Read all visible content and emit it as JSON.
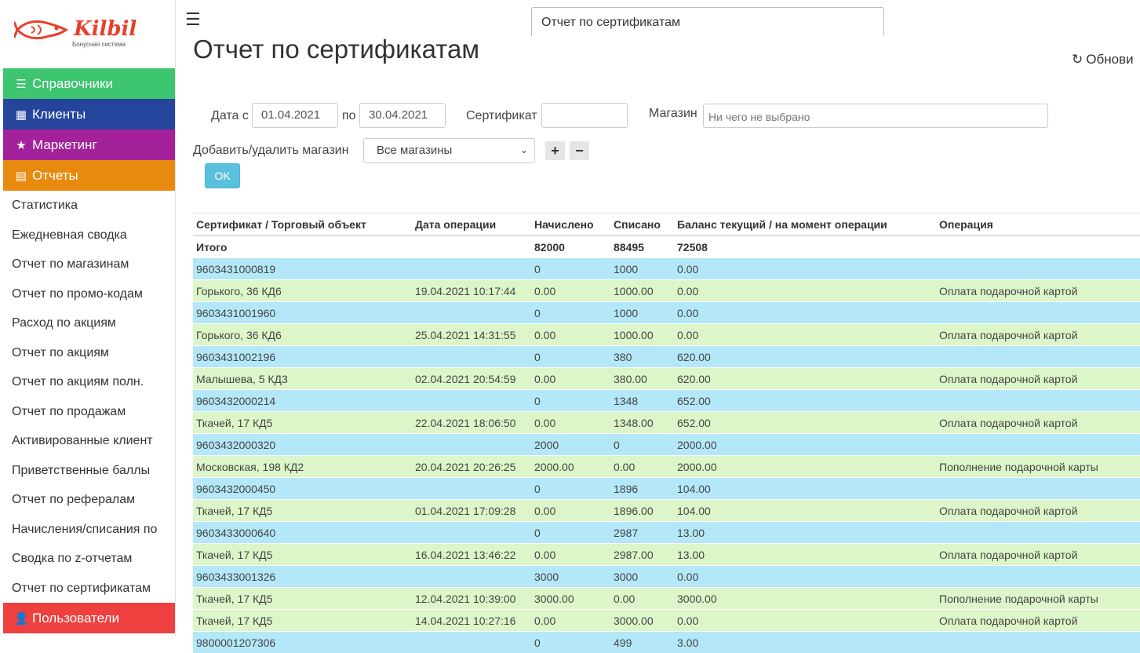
{
  "logo": {
    "brand": "Kilbil",
    "tagline": "Бонусная система"
  },
  "sidebar": {
    "main_top": [
      {
        "label": "Справочники",
        "icon": "list-icon",
        "color": "#3dc56f"
      },
      {
        "label": "Клиенты",
        "icon": "grid-icon",
        "color": "#25449b"
      },
      {
        "label": "Маркетинг",
        "icon": "star-icon",
        "color": "#a3219a"
      },
      {
        "label": "Отчеты",
        "icon": "report-icon",
        "color": "#e88a0e"
      }
    ],
    "reports": [
      "Статистика",
      "Ежедневная сводка",
      "Отчет по магазинам",
      "Отчет по промо-кодам",
      "Расход по акциям",
      "Отчет по акциям",
      "Отчет по акциям полн.",
      "Отчет по продажам",
      "Активированные клиент",
      "Приветственные баллы",
      "Отчет по рефералам",
      "Начисления/списания по",
      "Сводка по z-отчетам",
      "Отчет по сертификатам"
    ],
    "users": {
      "label": "Пользователи",
      "icon": "user-icon",
      "color": "#ef4040"
    }
  },
  "header": {
    "tab_label": "Отчет по сертификатам",
    "title": "Отчет по сертификатам",
    "refresh_label": "Обнови"
  },
  "filters": {
    "date_from_label": "Дата с",
    "date_from": "01.04.2021",
    "date_to_label": "по",
    "date_to": "30.04.2021",
    "certificate_label": "Сертификат",
    "certificate_value": "",
    "store_label": "Магазин",
    "store_placeholder": "Ни чего не выбрано",
    "add_remove_label": "Добавить/удалить магазин",
    "store_select": "Все магазины",
    "plus": "+",
    "minus": "−",
    "ok_label": "OK"
  },
  "table": {
    "columns": [
      "Сертификат / Торговый объект",
      "Дата операции",
      "Начислено",
      "Списано",
      "Баланс текущий / на момент операции",
      "Операция"
    ],
    "total": {
      "label": "Итого",
      "accrued": "82000",
      "written_off": "88495",
      "balance": "72508"
    },
    "rows": [
      {
        "kind": "cert",
        "cells": [
          "9603431000819",
          "",
          "0",
          "1000",
          "0.00",
          ""
        ]
      },
      {
        "kind": "op",
        "cells": [
          "Горького, 36 КД6",
          "19.04.2021 10:17:44",
          "0.00",
          "1000.00",
          "0.00",
          "Оплата подарочной картой"
        ]
      },
      {
        "kind": "cert",
        "cells": [
          "9603431001960",
          "",
          "0",
          "1000",
          "0.00",
          ""
        ]
      },
      {
        "kind": "op",
        "cells": [
          "Горького, 36 КД6",
          "25.04.2021 14:31:55",
          "0.00",
          "1000.00",
          "0.00",
          "Оплата подарочной картой"
        ]
      },
      {
        "kind": "cert",
        "cells": [
          "9603431002196",
          "",
          "0",
          "380",
          "620.00",
          ""
        ]
      },
      {
        "kind": "op",
        "cells": [
          "Малышева, 5 КД3",
          "02.04.2021 20:54:59",
          "0.00",
          "380.00",
          "620.00",
          "Оплата подарочной картой"
        ]
      },
      {
        "kind": "cert",
        "cells": [
          "9603432000214",
          "",
          "0",
          "1348",
          "652.00",
          ""
        ]
      },
      {
        "kind": "op",
        "cells": [
          "Ткачей, 17 КД5",
          "22.04.2021 18:06:50",
          "0.00",
          "1348.00",
          "652.00",
          "Оплата подарочной картой"
        ]
      },
      {
        "kind": "cert",
        "cells": [
          "9603432000320",
          "",
          "2000",
          "0",
          "2000.00",
          ""
        ]
      },
      {
        "kind": "op",
        "cells": [
          "Московская, 198 КД2",
          "20.04.2021 20:26:25",
          "2000.00",
          "0.00",
          "2000.00",
          "Пополнение подарочной карты"
        ]
      },
      {
        "kind": "cert",
        "cells": [
          "9603432000450",
          "",
          "0",
          "1896",
          "104.00",
          ""
        ]
      },
      {
        "kind": "op",
        "cells": [
          "Ткачей, 17 КД5",
          "01.04.2021 17:09:28",
          "0.00",
          "1896.00",
          "104.00",
          "Оплата подарочной картой"
        ]
      },
      {
        "kind": "cert",
        "cells": [
          "9603433000640",
          "",
          "0",
          "2987",
          "13.00",
          ""
        ]
      },
      {
        "kind": "op",
        "cells": [
          "Ткачей, 17 КД5",
          "16.04.2021 13:46:22",
          "0.00",
          "2987.00",
          "13.00",
          "Оплата подарочной картой"
        ]
      },
      {
        "kind": "cert",
        "cells": [
          "9603433001326",
          "",
          "3000",
          "3000",
          "0.00",
          ""
        ]
      },
      {
        "kind": "op",
        "cells": [
          "Ткачей, 17 КД5",
          "12.04.2021 10:39:00",
          "3000.00",
          "0.00",
          "3000.00",
          "Пополнение подарочной карты"
        ]
      },
      {
        "kind": "op",
        "cells": [
          "Ткачей, 17 КД5",
          "14.04.2021 10:27:16",
          "0.00",
          "3000.00",
          "0.00",
          "Оплата подарочной картой"
        ]
      },
      {
        "kind": "cert",
        "cells": [
          "9800001207306",
          "",
          "0",
          "499",
          "3.00",
          ""
        ]
      }
    ]
  }
}
